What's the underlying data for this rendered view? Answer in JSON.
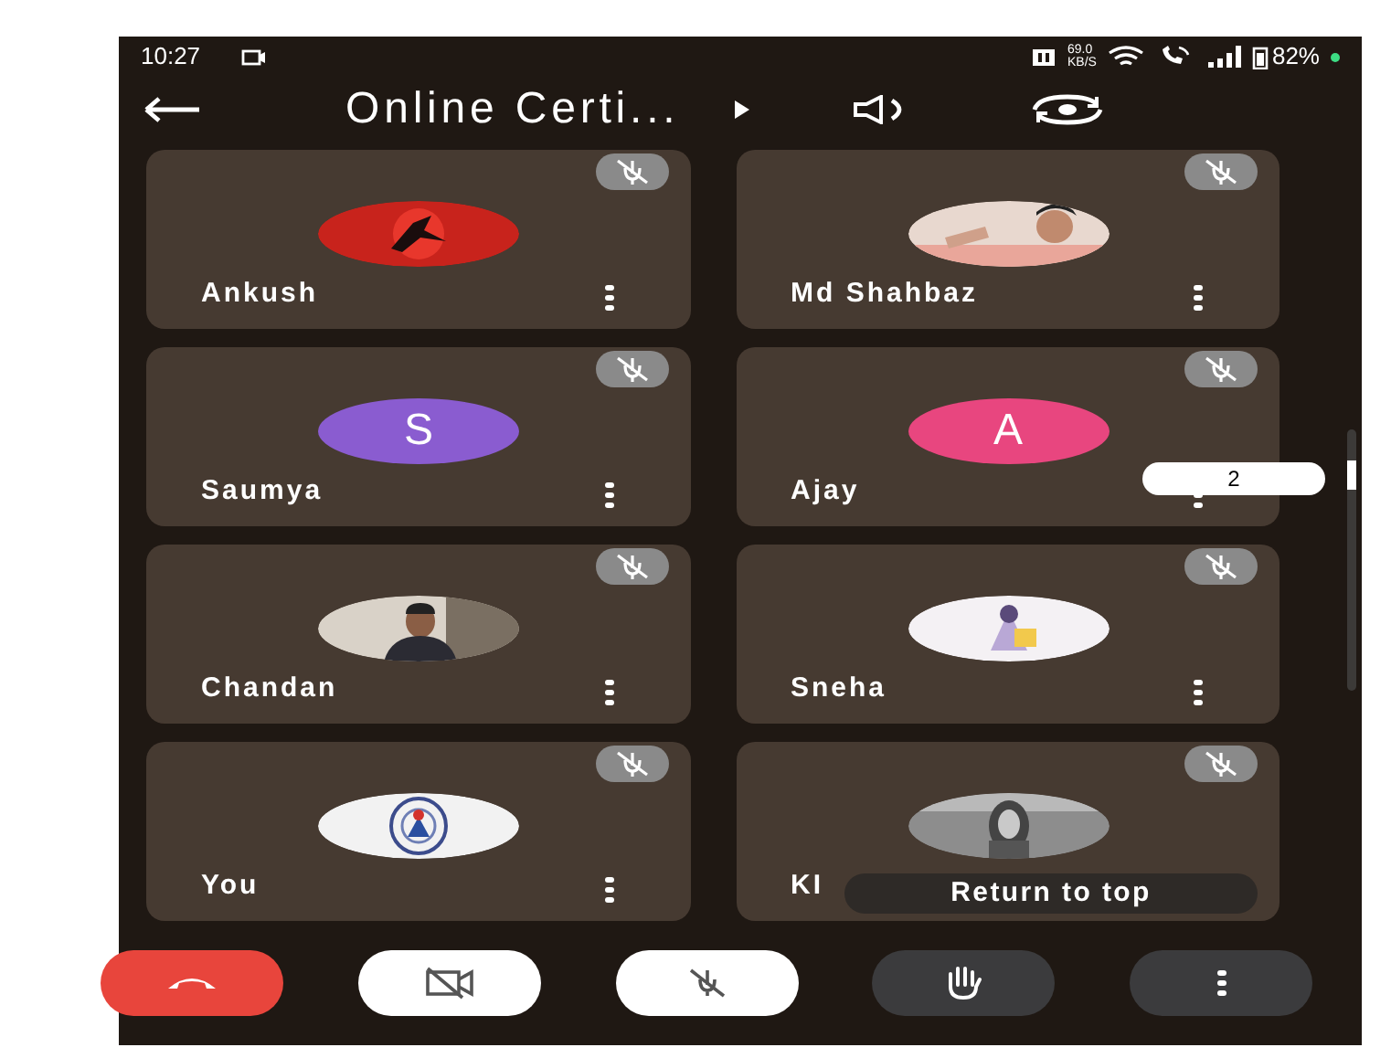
{
  "status_bar": {
    "time": "10:27",
    "speed_value": "69.0",
    "speed_unit": "KB/S",
    "battery": "82%"
  },
  "header": {
    "title": "Online Certi..."
  },
  "participants": [
    {
      "name": "Ankush",
      "muted": true
    },
    {
      "name": "Md Shahbaz",
      "muted": true
    },
    {
      "name": "Saumya",
      "avatar": {
        "kind": "letter",
        "letter": "S",
        "color": "#8a5cd0"
      },
      "muted": true
    },
    {
      "name": "Ajay",
      "avatar": {
        "kind": "letter",
        "letter": "A",
        "color": "#e8467f"
      },
      "muted": true
    },
    {
      "name": "Chandan",
      "muted": true
    },
    {
      "name": "Sneha",
      "muted": true
    },
    {
      "name": "You",
      "muted": true
    },
    {
      "name": "KI",
      "muted": true
    }
  ],
  "page_indicator": "2",
  "return_to_top": "Return to top",
  "controls": [
    {
      "kind": "end-call"
    },
    {
      "kind": "camera-off"
    },
    {
      "kind": "mic-off"
    },
    {
      "kind": "raise-hand"
    },
    {
      "kind": "more"
    }
  ]
}
